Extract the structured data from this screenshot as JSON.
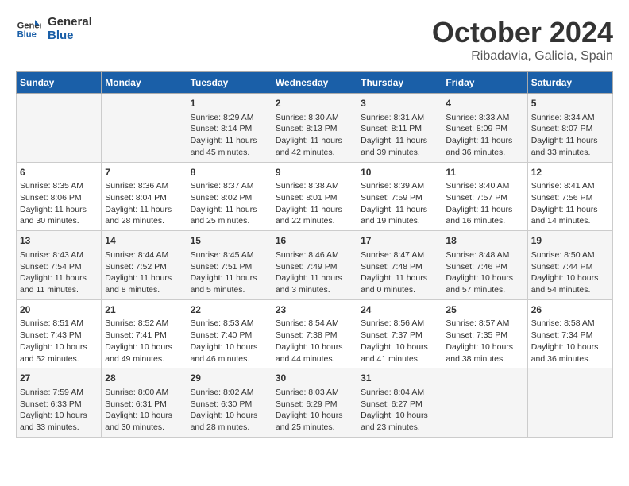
{
  "header": {
    "logo_line1": "General",
    "logo_line2": "Blue",
    "title": "October 2024",
    "subtitle": "Ribadavia, Galicia, Spain"
  },
  "weekdays": [
    "Sunday",
    "Monday",
    "Tuesday",
    "Wednesday",
    "Thursday",
    "Friday",
    "Saturday"
  ],
  "weeks": [
    [
      {
        "day": "",
        "info": ""
      },
      {
        "day": "",
        "info": ""
      },
      {
        "day": "1",
        "info": "Sunrise: 8:29 AM\nSunset: 8:14 PM\nDaylight: 11 hours and 45 minutes."
      },
      {
        "day": "2",
        "info": "Sunrise: 8:30 AM\nSunset: 8:13 PM\nDaylight: 11 hours and 42 minutes."
      },
      {
        "day": "3",
        "info": "Sunrise: 8:31 AM\nSunset: 8:11 PM\nDaylight: 11 hours and 39 minutes."
      },
      {
        "day": "4",
        "info": "Sunrise: 8:33 AM\nSunset: 8:09 PM\nDaylight: 11 hours and 36 minutes."
      },
      {
        "day": "5",
        "info": "Sunrise: 8:34 AM\nSunset: 8:07 PM\nDaylight: 11 hours and 33 minutes."
      }
    ],
    [
      {
        "day": "6",
        "info": "Sunrise: 8:35 AM\nSunset: 8:06 PM\nDaylight: 11 hours and 30 minutes."
      },
      {
        "day": "7",
        "info": "Sunrise: 8:36 AM\nSunset: 8:04 PM\nDaylight: 11 hours and 28 minutes."
      },
      {
        "day": "8",
        "info": "Sunrise: 8:37 AM\nSunset: 8:02 PM\nDaylight: 11 hours and 25 minutes."
      },
      {
        "day": "9",
        "info": "Sunrise: 8:38 AM\nSunset: 8:01 PM\nDaylight: 11 hours and 22 minutes."
      },
      {
        "day": "10",
        "info": "Sunrise: 8:39 AM\nSunset: 7:59 PM\nDaylight: 11 hours and 19 minutes."
      },
      {
        "day": "11",
        "info": "Sunrise: 8:40 AM\nSunset: 7:57 PM\nDaylight: 11 hours and 16 minutes."
      },
      {
        "day": "12",
        "info": "Sunrise: 8:41 AM\nSunset: 7:56 PM\nDaylight: 11 hours and 14 minutes."
      }
    ],
    [
      {
        "day": "13",
        "info": "Sunrise: 8:43 AM\nSunset: 7:54 PM\nDaylight: 11 hours and 11 minutes."
      },
      {
        "day": "14",
        "info": "Sunrise: 8:44 AM\nSunset: 7:52 PM\nDaylight: 11 hours and 8 minutes."
      },
      {
        "day": "15",
        "info": "Sunrise: 8:45 AM\nSunset: 7:51 PM\nDaylight: 11 hours and 5 minutes."
      },
      {
        "day": "16",
        "info": "Sunrise: 8:46 AM\nSunset: 7:49 PM\nDaylight: 11 hours and 3 minutes."
      },
      {
        "day": "17",
        "info": "Sunrise: 8:47 AM\nSunset: 7:48 PM\nDaylight: 11 hours and 0 minutes."
      },
      {
        "day": "18",
        "info": "Sunrise: 8:48 AM\nSunset: 7:46 PM\nDaylight: 10 hours and 57 minutes."
      },
      {
        "day": "19",
        "info": "Sunrise: 8:50 AM\nSunset: 7:44 PM\nDaylight: 10 hours and 54 minutes."
      }
    ],
    [
      {
        "day": "20",
        "info": "Sunrise: 8:51 AM\nSunset: 7:43 PM\nDaylight: 10 hours and 52 minutes."
      },
      {
        "day": "21",
        "info": "Sunrise: 8:52 AM\nSunset: 7:41 PM\nDaylight: 10 hours and 49 minutes."
      },
      {
        "day": "22",
        "info": "Sunrise: 8:53 AM\nSunset: 7:40 PM\nDaylight: 10 hours and 46 minutes."
      },
      {
        "day": "23",
        "info": "Sunrise: 8:54 AM\nSunset: 7:38 PM\nDaylight: 10 hours and 44 minutes."
      },
      {
        "day": "24",
        "info": "Sunrise: 8:56 AM\nSunset: 7:37 PM\nDaylight: 10 hours and 41 minutes."
      },
      {
        "day": "25",
        "info": "Sunrise: 8:57 AM\nSunset: 7:35 PM\nDaylight: 10 hours and 38 minutes."
      },
      {
        "day": "26",
        "info": "Sunrise: 8:58 AM\nSunset: 7:34 PM\nDaylight: 10 hours and 36 minutes."
      }
    ],
    [
      {
        "day": "27",
        "info": "Sunrise: 7:59 AM\nSunset: 6:33 PM\nDaylight: 10 hours and 33 minutes."
      },
      {
        "day": "28",
        "info": "Sunrise: 8:00 AM\nSunset: 6:31 PM\nDaylight: 10 hours and 30 minutes."
      },
      {
        "day": "29",
        "info": "Sunrise: 8:02 AM\nSunset: 6:30 PM\nDaylight: 10 hours and 28 minutes."
      },
      {
        "day": "30",
        "info": "Sunrise: 8:03 AM\nSunset: 6:29 PM\nDaylight: 10 hours and 25 minutes."
      },
      {
        "day": "31",
        "info": "Sunrise: 8:04 AM\nSunset: 6:27 PM\nDaylight: 10 hours and 23 minutes."
      },
      {
        "day": "",
        "info": ""
      },
      {
        "day": "",
        "info": ""
      }
    ]
  ]
}
